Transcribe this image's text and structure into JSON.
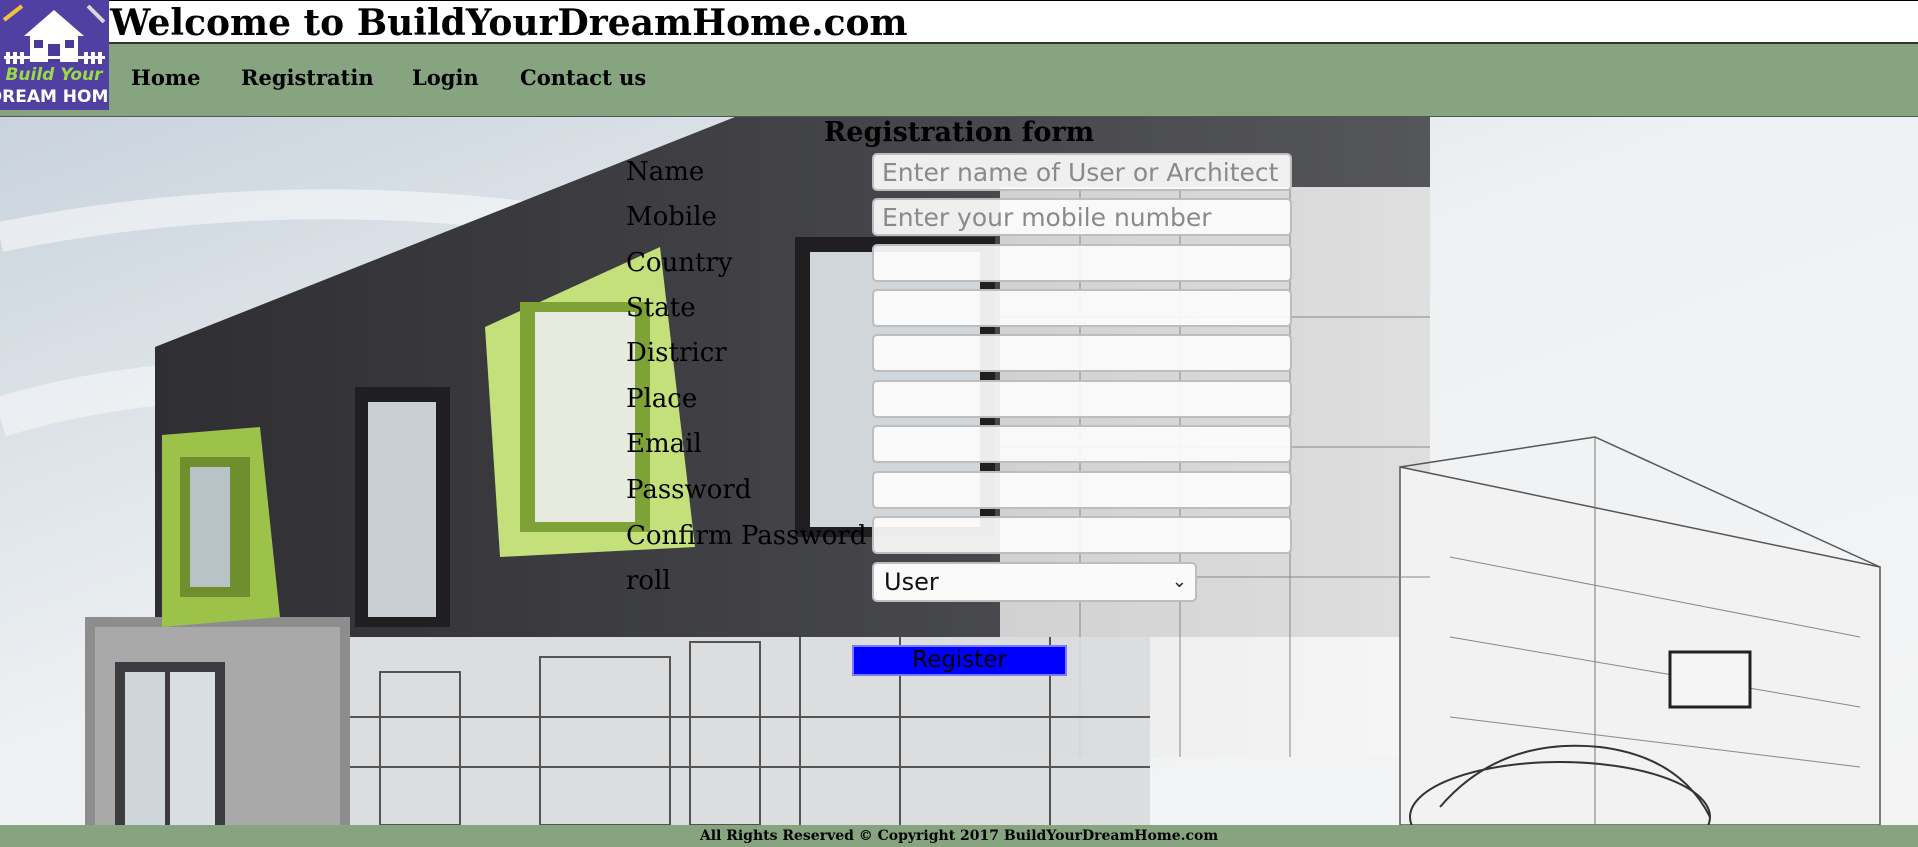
{
  "header": {
    "logo_line1": "Build Your",
    "logo_line2": "DREAM HOME",
    "title": "Welcome to BuildYourDreamHome.com"
  },
  "nav": {
    "items": [
      {
        "label": "Home"
      },
      {
        "label": "Registratin"
      },
      {
        "label": "Login"
      },
      {
        "label": "Contact us"
      }
    ]
  },
  "form": {
    "title": "Registration form",
    "fields": [
      {
        "label": "Name",
        "placeholder": "Enter name of User or Architect or",
        "value": ""
      },
      {
        "label": "Mobile",
        "placeholder": "Enter your mobile number",
        "value": ""
      },
      {
        "label": "Country",
        "placeholder": "",
        "value": ""
      },
      {
        "label": "State",
        "placeholder": "",
        "value": ""
      },
      {
        "label": "Districr",
        "placeholder": "",
        "value": ""
      },
      {
        "label": "Place",
        "placeholder": "",
        "value": ""
      },
      {
        "label": "Email",
        "placeholder": "",
        "value": ""
      },
      {
        "label": "Password",
        "placeholder": "",
        "value": ""
      },
      {
        "label": "Confirm Password",
        "placeholder": "",
        "value": ""
      }
    ],
    "role": {
      "label": "roll",
      "selected": "User"
    },
    "submit_label": "Register"
  },
  "footer": {
    "text": "All Rights Reserved © Copyright 2017 BuildYourDreamHome.com"
  },
  "colors": {
    "nav_bg": "#86a480",
    "button_bg": "#0000ff",
    "logo_bg": "#4a3a9a",
    "accent_green": "#9cc24a"
  }
}
